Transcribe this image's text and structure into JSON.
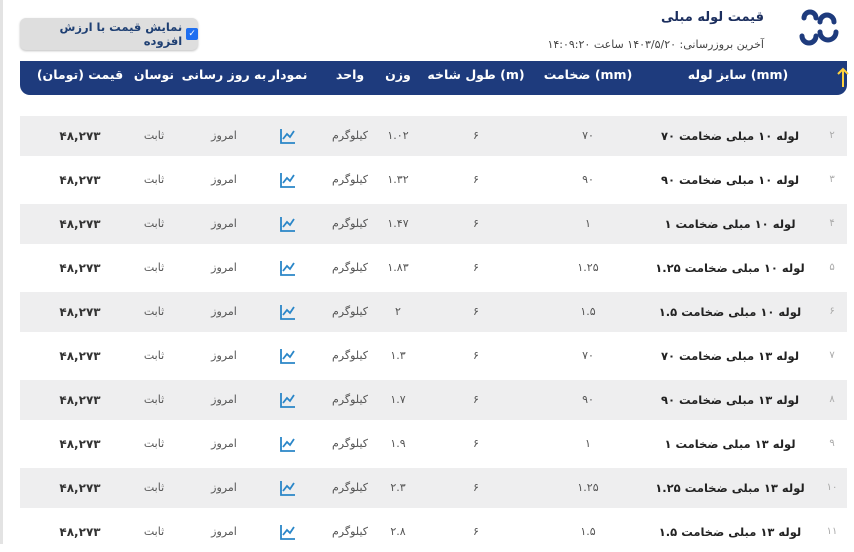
{
  "header": {
    "title": "قیمت لوله مبلی",
    "last_update": "آخرین بروزرسانی: ۱۴۰۳/۵/۲۰ ساعت ۱۴:۰۹:۲۰",
    "vat_toggle_label": "نمایش قیمت با ارزش افزوده",
    "vat_checked": true,
    "logo_icon": "brand-logo-icon"
  },
  "colors": {
    "header_bg": "#1e3b7d",
    "band_bg": "#eeeeef",
    "accent": "#1f6ff0",
    "chart_icon": "#2a86c8"
  },
  "columns": {
    "size": "سایز لوله (mm)",
    "thickness": "ضخامت (mm)",
    "length": "طول شاخه (m)",
    "weight": "وزن",
    "unit": "واحد",
    "chart": "نمودار",
    "updated": "به روز رسانی",
    "trend": "نوسان",
    "price": "قیمت (تومان)"
  },
  "rows": [
    {
      "idx": "۲",
      "name": "لوله ۱۰ مبلی ضخامت ۷۰",
      "thickness": "۷۰",
      "length": "۶",
      "weight": "۱.۰۲",
      "unit": "کیلوگرم",
      "updated": "امروز",
      "trend": "ثابت",
      "price": "۴۸,۲۷۳"
    },
    {
      "idx": "۳",
      "name": "لوله ۱۰ مبلی ضخامت ۹۰",
      "thickness": "۹۰",
      "length": "۶",
      "weight": "۱.۳۲",
      "unit": "کیلوگرم",
      "updated": "امروز",
      "trend": "ثابت",
      "price": "۴۸,۲۷۳"
    },
    {
      "idx": "۴",
      "name": "لوله ۱۰ مبلی ضخامت ۱",
      "thickness": "۱",
      "length": "۶",
      "weight": "۱.۴۷",
      "unit": "کیلوگرم",
      "updated": "امروز",
      "trend": "ثابت",
      "price": "۴۸,۲۷۳"
    },
    {
      "idx": "۵",
      "name": "لوله ۱۰ مبلی ضخامت ۱.۲۵",
      "thickness": "۱.۲۵",
      "length": "۶",
      "weight": "۱.۸۳",
      "unit": "کیلوگرم",
      "updated": "امروز",
      "trend": "ثابت",
      "price": "۴۸,۲۷۳"
    },
    {
      "idx": "۶",
      "name": "لوله ۱۰ مبلی ضخامت ۱.۵",
      "thickness": "۱.۵",
      "length": "۶",
      "weight": "۲",
      "unit": "کیلوگرم",
      "updated": "امروز",
      "trend": "ثابت",
      "price": "۴۸,۲۷۳"
    },
    {
      "idx": "۷",
      "name": "لوله ۱۳ مبلی ضخامت ۷۰",
      "thickness": "۷۰",
      "length": "۶",
      "weight": "۱.۳",
      "unit": "کیلوگرم",
      "updated": "امروز",
      "trend": "ثابت",
      "price": "۴۸,۲۷۳"
    },
    {
      "idx": "۸",
      "name": "لوله ۱۳ مبلی ضخامت ۹۰",
      "thickness": "۹۰",
      "length": "۶",
      "weight": "۱.۷",
      "unit": "کیلوگرم",
      "updated": "امروز",
      "trend": "ثابت",
      "price": "۴۸,۲۷۳"
    },
    {
      "idx": "۹",
      "name": "لوله ۱۳ مبلی ضخامت ۱",
      "thickness": "۱",
      "length": "۶",
      "weight": "۱.۹",
      "unit": "کیلوگرم",
      "updated": "امروز",
      "trend": "ثابت",
      "price": "۴۸,۲۷۳"
    },
    {
      "idx": "۱۰",
      "name": "لوله ۱۳ مبلی ضخامت ۱.۲۵",
      "thickness": "۱.۲۵",
      "length": "۶",
      "weight": "۲.۳",
      "unit": "کیلوگرم",
      "updated": "امروز",
      "trend": "ثابت",
      "price": "۴۸,۲۷۳"
    },
    {
      "idx": "۱۱",
      "name": "لوله ۱۳ مبلی ضخامت ۱.۵",
      "thickness": "۱.۵",
      "length": "۶",
      "weight": "۲.۸",
      "unit": "کیلوگرم",
      "updated": "امروز",
      "trend": "ثابت",
      "price": "۴۸,۲۷۳"
    }
  ]
}
